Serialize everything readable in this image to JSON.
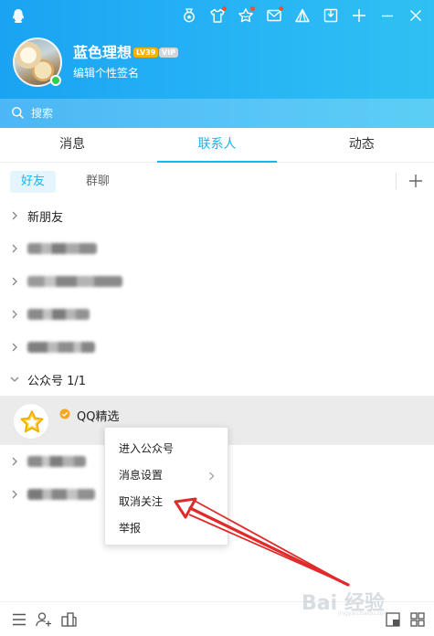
{
  "header": {
    "nickname": "蓝色理想",
    "level_badge": "LV39",
    "vip_badge": "VIP",
    "signature": "编辑个性签名",
    "icons": [
      "qq-penguin-icon",
      "medal-icon",
      "tshirt-icon",
      "star-icon",
      "mail-icon",
      "tent-icon",
      "inbox-icon",
      "plus-icon",
      "minimize-icon",
      "close-icon"
    ],
    "accent": "#1aa3f2"
  },
  "search": {
    "placeholder": "搜索"
  },
  "tabs": [
    {
      "label": "消息",
      "active": false
    },
    {
      "label": "联系人",
      "active": true
    },
    {
      "label": "动态",
      "active": false
    }
  ],
  "subtabs": [
    {
      "label": "好友",
      "active": true
    },
    {
      "label": "群聊",
      "active": false
    }
  ],
  "groups": {
    "new_friends": "新朋友",
    "public_accounts": "公众号 1/1"
  },
  "contact": {
    "name": "QQ精选",
    "icon": "star-icon"
  },
  "context_menu": {
    "items": [
      {
        "label": "进入公众号",
        "submenu": false
      },
      {
        "label": "消息设置",
        "submenu": true
      },
      {
        "label": "取消关注",
        "submenu": false
      },
      {
        "label": "举报",
        "submenu": false
      }
    ]
  },
  "bottom_bar": {
    "icons": [
      "menu-icon",
      "add-contact-icon",
      "apps-icon",
      "window-mode-icon",
      "app-manager-icon"
    ]
  },
  "watermark": {
    "text": "Bai 经验",
    "sub": "jingyan.baidu.com"
  },
  "colors": {
    "active_tab": "#12b7f5",
    "annotation_arrow": "#e02b2b",
    "online": "#2fd04f"
  }
}
